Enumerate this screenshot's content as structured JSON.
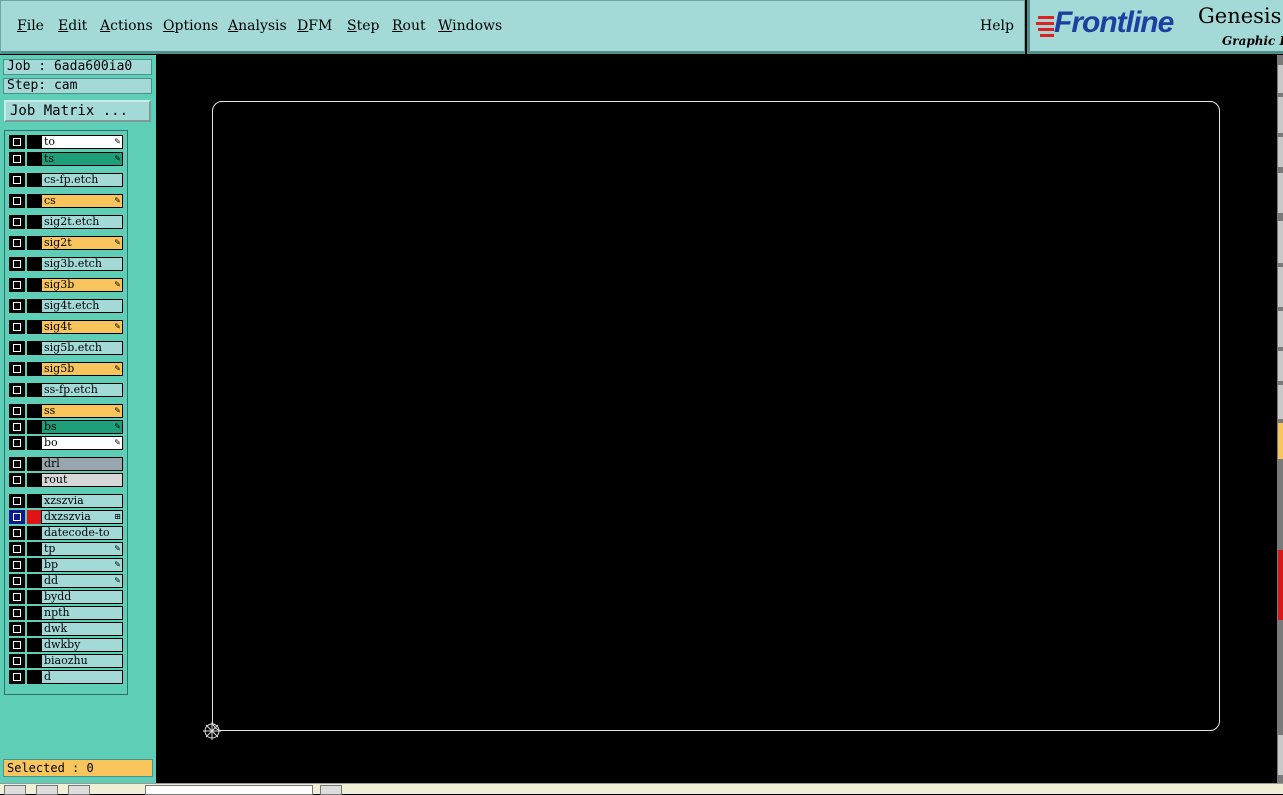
{
  "menu": {
    "items": [
      "File",
      "Edit",
      "Actions",
      "Options",
      "Analysis",
      "DFM",
      "Step",
      "Rout",
      "Windows"
    ],
    "help": "Help"
  },
  "logo": {
    "brand": "Frontline",
    "product": "Genesis",
    "subtitle": "Graphic Ed"
  },
  "job": {
    "job_label": "Job : 6ada600ia0",
    "step_label": "Step: cam",
    "matrix_button": "Job Matrix ..."
  },
  "layers": [
    {
      "name": "to",
      "color": "#ffffff",
      "flag": true
    },
    {
      "name": "ts",
      "color": "#1f9e7a",
      "flag": true
    },
    {
      "name": "cs-fp.etch",
      "color": "#a3dad8",
      "flag": false
    },
    {
      "name": "cs",
      "color": "#f7c55c",
      "flag": true
    },
    {
      "name": "sig2t.etch",
      "color": "#a3dad8",
      "flag": false
    },
    {
      "name": "sig2t",
      "color": "#f7c55c",
      "flag": true
    },
    {
      "name": "sig3b.etch",
      "color": "#a3dad8",
      "flag": false
    },
    {
      "name": "sig3b",
      "color": "#f7c55c",
      "flag": true
    },
    {
      "name": "sig4t.etch",
      "color": "#a3dad8",
      "flag": false
    },
    {
      "name": "sig4t",
      "color": "#f7c55c",
      "flag": true
    },
    {
      "name": "sig5b.etch",
      "color": "#a3dad8",
      "flag": false
    },
    {
      "name": "sig5b",
      "color": "#f7c55c",
      "flag": true
    },
    {
      "name": "ss-fp.etch",
      "color": "#a3dad8",
      "flag": false
    },
    {
      "name": "ss",
      "color": "#f7c55c",
      "flag": true
    },
    {
      "name": "bs",
      "color": "#1f9e7a",
      "flag": true
    },
    {
      "name": "bo",
      "color": "#ffffff",
      "flag": true
    },
    {
      "name": "drl",
      "color": "#9aa6ad",
      "flag": false
    },
    {
      "name": "rout",
      "color": "#d8d8d8",
      "flag": false
    },
    {
      "name": "xzszvia",
      "color": "#a3dad8",
      "flag": false
    },
    {
      "name": "dxzszvia",
      "color": "#a3dad8",
      "flag": false,
      "active": true
    },
    {
      "name": "datecode-to",
      "color": "#a3dad8",
      "flag": false
    },
    {
      "name": "tp",
      "color": "#a3dad8",
      "flag": true
    },
    {
      "name": "bp",
      "color": "#a3dad8",
      "flag": true
    },
    {
      "name": "dd",
      "color": "#a3dad8",
      "flag": true
    },
    {
      "name": "bydd",
      "color": "#a3dad8",
      "flag": false
    },
    {
      "name": "npth",
      "color": "#a3dad8",
      "flag": false
    },
    {
      "name": "dwk",
      "color": "#a3dad8",
      "flag": false
    },
    {
      "name": "dwkby",
      "color": "#a3dad8",
      "flag": false
    },
    {
      "name": "biaozhu",
      "color": "#a3dad8",
      "flag": false
    },
    {
      "name": "d",
      "color": "#a3dad8",
      "flag": false
    }
  ],
  "status": {
    "selected": "Selected : 0"
  }
}
